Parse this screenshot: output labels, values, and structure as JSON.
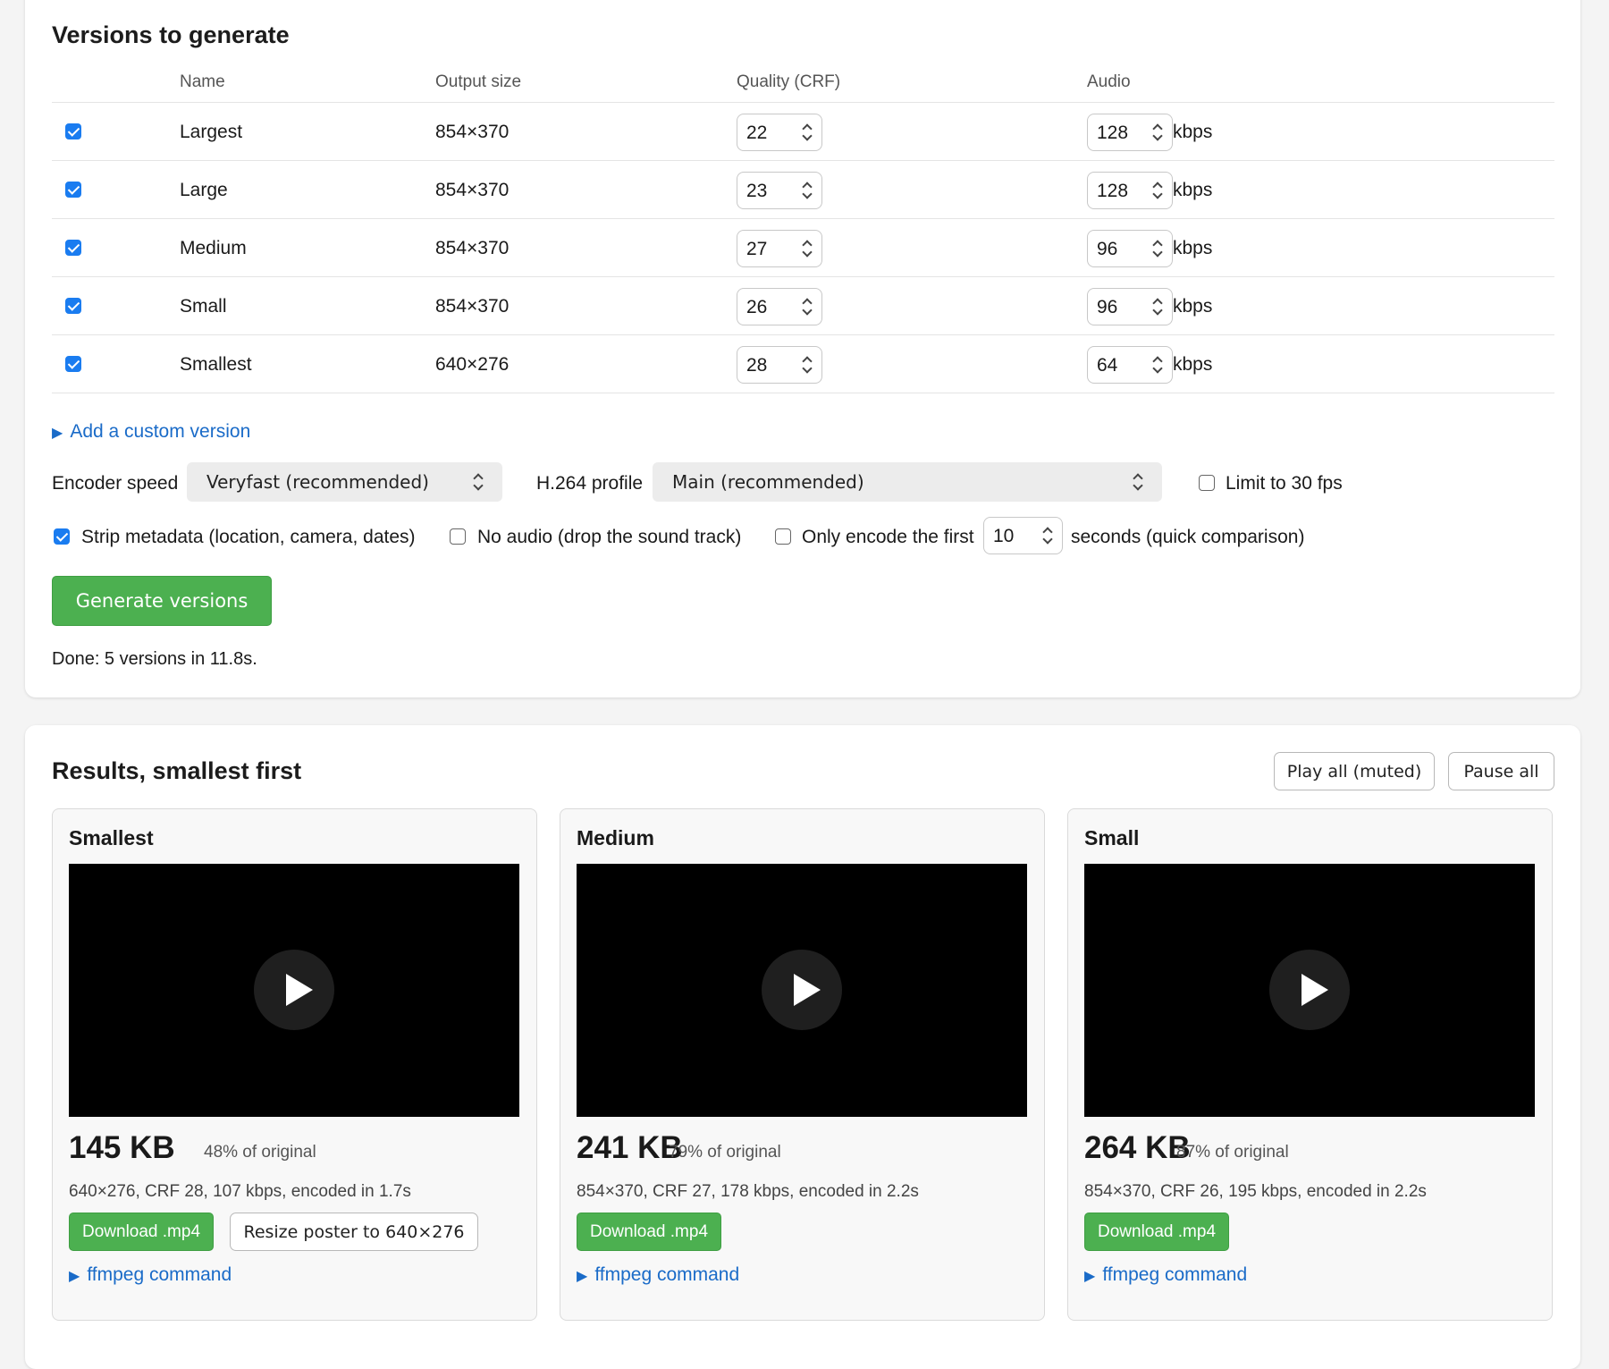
{
  "versions": {
    "title": "Versions to generate",
    "headers": {
      "name": "Name",
      "size": "Output size",
      "crf": "Quality (CRF)",
      "audio": "Audio"
    },
    "rows": [
      {
        "checked": true,
        "name": "Largest",
        "size": "854×370",
        "crf": "22",
        "audio": "128",
        "unit": "kbps"
      },
      {
        "checked": true,
        "name": "Large",
        "size": "854×370",
        "crf": "23",
        "audio": "128",
        "unit": "kbps"
      },
      {
        "checked": true,
        "name": "Medium",
        "size": "854×370",
        "crf": "27",
        "audio": "96",
        "unit": "kbps"
      },
      {
        "checked": true,
        "name": "Small",
        "size": "854×370",
        "crf": "26",
        "audio": "96",
        "unit": "kbps"
      },
      {
        "checked": true,
        "name": "Smallest",
        "size": "640×276",
        "crf": "28",
        "audio": "64",
        "unit": "kbps"
      }
    ],
    "add_custom": "Add a custom version",
    "encoder_speed_label": "Encoder speed",
    "encoder_speed_value": "Veryfast (recommended)",
    "profile_label": "H.264 profile",
    "profile_value": "Main (recommended)",
    "limit_fps": {
      "label": "Limit to 30 fps",
      "checked": false
    },
    "strip_metadata": {
      "label": "Strip metadata (location, camera, dates)",
      "checked": true
    },
    "no_audio": {
      "label": "No audio (drop the sound track)",
      "checked": false
    },
    "encode_first": {
      "label": "Only encode the first",
      "checked": false,
      "value": "10",
      "suffix": "seconds (quick comparison)"
    },
    "generate_button": "Generate versions",
    "status": "Done: 5 versions in 11.8s."
  },
  "results": {
    "title": "Results, smallest first",
    "play_all": "Play all (muted)",
    "pause_all": "Pause all",
    "cards": [
      {
        "title": "Smallest",
        "size": "145 KB",
        "pct": "48% of original",
        "meta": "640×276, CRF 28, 107 kbps, encoded in 1.7s",
        "download": "Download .mp4",
        "resize": "Resize poster to 640×276",
        "ffmpeg": "ffmpeg command"
      },
      {
        "title": "Medium",
        "size": "241 KB",
        "pct": "79% of original",
        "meta": "854×370, CRF 27, 178 kbps, encoded in 2.2s",
        "download": "Download .mp4",
        "ffmpeg": "ffmpeg command"
      },
      {
        "title": "Small",
        "size": "264 KB",
        "pct": "87% of original",
        "meta": "854×370, CRF 26, 195 kbps, encoded in 2.2s",
        "download": "Download .mp4",
        "ffmpeg": "ffmpeg command"
      }
    ]
  },
  "icons": {
    "disclosure": "disclosure-triangle-icon",
    "play": "play-icon",
    "spinner": "stepper-icon"
  },
  "colors": {
    "accent_green": "#4cb050",
    "link_blue": "#1a6bc8",
    "checkbox_blue": "#1a7cf0"
  }
}
